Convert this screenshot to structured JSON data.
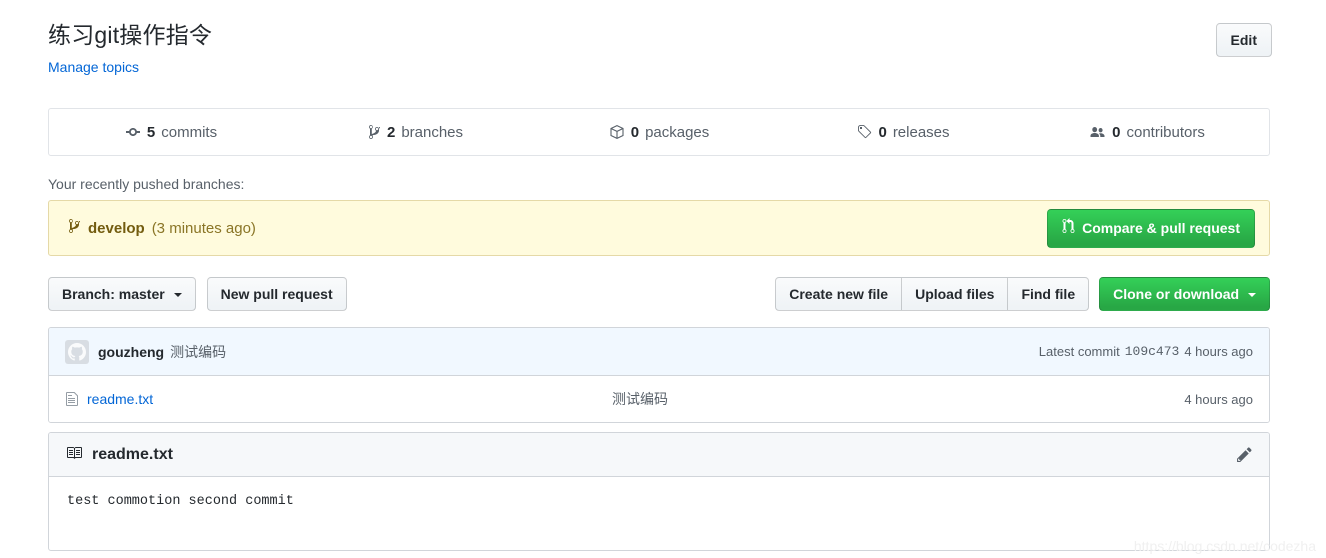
{
  "repo": {
    "title": "练习git操作指令",
    "manage_topics_label": "Manage topics",
    "edit_button_label": "Edit"
  },
  "stats": [
    {
      "icon": "commit-icon",
      "count": "5",
      "label": "commits"
    },
    {
      "icon": "branch-icon",
      "count": "2",
      "label": "branches"
    },
    {
      "icon": "package-icon",
      "count": "0",
      "label": "packages"
    },
    {
      "icon": "tag-icon",
      "count": "0",
      "label": "releases"
    },
    {
      "icon": "contributors-icon",
      "count": "0",
      "label": "contributors"
    }
  ],
  "recently_pushed": {
    "label": "Your recently pushed branches:",
    "branch_name": "develop",
    "branch_time": "(3 minutes ago)",
    "compare_button_label": "Compare & pull request"
  },
  "toolbar": {
    "branch_button_label": "Branch: master",
    "new_pull_request_label": "New pull request",
    "create_new_file_label": "Create new file",
    "upload_files_label": "Upload files",
    "find_file_label": "Find file",
    "clone_button_label": "Clone or download"
  },
  "commit_row": {
    "author": "gouzheng",
    "message": "测试编码",
    "latest_commit_label": "Latest commit",
    "sha": "109c473",
    "age": "4 hours ago"
  },
  "files": [
    {
      "icon": "file-text-icon",
      "name": "readme.txt",
      "message": "测试编码",
      "age": "4 hours ago"
    }
  ],
  "readme": {
    "icon": "book-icon",
    "title": "readme.txt",
    "edit_icon": "pencil-icon",
    "content": "test commotion second commit"
  },
  "watermark": "https://blog.csdn.net/codezha",
  "colors": {
    "link": "#0366d6",
    "green_button": "#28a745",
    "yellow_banner_bg": "#fffbdd",
    "yellow_banner_text": "#735c0f",
    "commit_row_bg": "#f1f8ff",
    "border": "#d1d5da"
  }
}
